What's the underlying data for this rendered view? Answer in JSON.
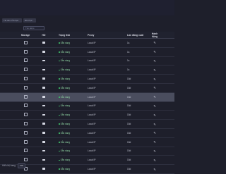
{
  "toolbar": {
    "chips": [
      "Tài sản của bạn",
      "Đã chọn"
    ],
    "search_placeholder": "Tìm kiếm"
  },
  "table": {
    "headers": [
      "Storage",
      "HD",
      "Trạng thái",
      "Proxy",
      "Lần đăng xuất",
      "Hành động"
    ],
    "rows": [
      {
        "status": "Sẵn sàng",
        "proxy": "Local IP",
        "date": "1s"
      },
      {
        "status": "Sẵn sàng",
        "proxy": "Local IP",
        "date": "1s"
      },
      {
        "status": "Sẵn sàng",
        "proxy": "Local IP",
        "date": "1s"
      },
      {
        "status": "Sẵn sàng",
        "proxy": "Local IP",
        "date": "1s"
      },
      {
        "status": "Sẵn sàng",
        "proxy": "Local IP",
        "date": "15d"
      },
      {
        "status": "Sẵn sàng",
        "proxy": "Local IP",
        "date": "15d"
      },
      {
        "status": "Sẵn sàng",
        "proxy": "Local IP",
        "date": "15d"
      },
      {
        "status": "Sẵn sàng",
        "proxy": "Local IP",
        "date": "15d"
      },
      {
        "status": "Sẵn sàng",
        "proxy": "Local IP",
        "date": "15d"
      },
      {
        "status": "Sẵn sàng",
        "proxy": "Local IP",
        "date": "15d"
      },
      {
        "status": "Sẵn sàng",
        "proxy": "Local IP",
        "date": "15d"
      },
      {
        "status": "Sẵn sàng",
        "proxy": "Local IP",
        "date": "15d"
      },
      {
        "status": "Sẵn sàng",
        "proxy": "Local IP",
        "date": "15d"
      },
      {
        "status": "Sẵn sàng",
        "proxy": "Local IP",
        "date": "15d"
      },
      {
        "status": "Sẵn sàng",
        "proxy": "Local IP",
        "date": "15d"
      }
    ],
    "selected_row": 6
  },
  "footer": {
    "label": "Hiển thị trang",
    "page_size": "100"
  },
  "colors": {
    "background": "#1e1f2b",
    "status_dot": "#3fbf6a",
    "selected_row": "#4a4d5e"
  },
  "icons": {
    "storage": "storage-icon",
    "hd": "hd-icon",
    "action": "edit-icon"
  }
}
